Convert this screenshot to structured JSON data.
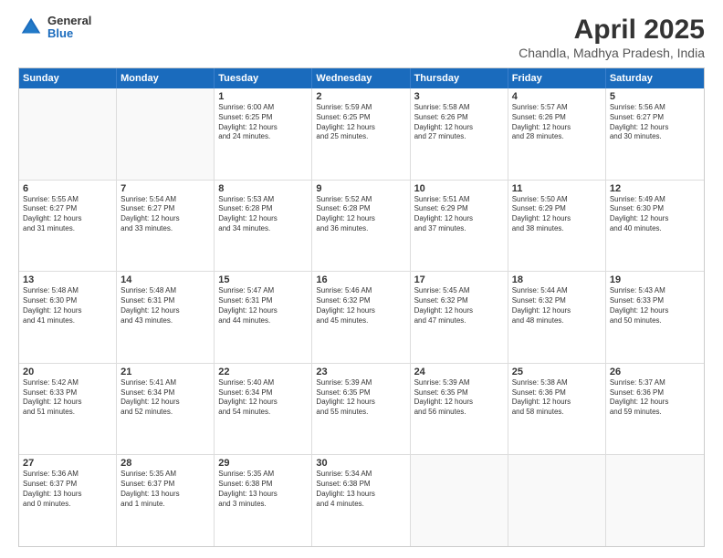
{
  "logo": {
    "line1": "General",
    "line2": "Blue"
  },
  "title": "April 2025",
  "subtitle": "Chandla, Madhya Pradesh, India",
  "header_days": [
    "Sunday",
    "Monday",
    "Tuesday",
    "Wednesday",
    "Thursday",
    "Friday",
    "Saturday"
  ],
  "rows": [
    [
      {
        "day": "",
        "info": ""
      },
      {
        "day": "",
        "info": ""
      },
      {
        "day": "1",
        "info": "Sunrise: 6:00 AM\nSunset: 6:25 PM\nDaylight: 12 hours\nand 24 minutes."
      },
      {
        "day": "2",
        "info": "Sunrise: 5:59 AM\nSunset: 6:25 PM\nDaylight: 12 hours\nand 25 minutes."
      },
      {
        "day": "3",
        "info": "Sunrise: 5:58 AM\nSunset: 6:26 PM\nDaylight: 12 hours\nand 27 minutes."
      },
      {
        "day": "4",
        "info": "Sunrise: 5:57 AM\nSunset: 6:26 PM\nDaylight: 12 hours\nand 28 minutes."
      },
      {
        "day": "5",
        "info": "Sunrise: 5:56 AM\nSunset: 6:27 PM\nDaylight: 12 hours\nand 30 minutes."
      }
    ],
    [
      {
        "day": "6",
        "info": "Sunrise: 5:55 AM\nSunset: 6:27 PM\nDaylight: 12 hours\nand 31 minutes."
      },
      {
        "day": "7",
        "info": "Sunrise: 5:54 AM\nSunset: 6:27 PM\nDaylight: 12 hours\nand 33 minutes."
      },
      {
        "day": "8",
        "info": "Sunrise: 5:53 AM\nSunset: 6:28 PM\nDaylight: 12 hours\nand 34 minutes."
      },
      {
        "day": "9",
        "info": "Sunrise: 5:52 AM\nSunset: 6:28 PM\nDaylight: 12 hours\nand 36 minutes."
      },
      {
        "day": "10",
        "info": "Sunrise: 5:51 AM\nSunset: 6:29 PM\nDaylight: 12 hours\nand 37 minutes."
      },
      {
        "day": "11",
        "info": "Sunrise: 5:50 AM\nSunset: 6:29 PM\nDaylight: 12 hours\nand 38 minutes."
      },
      {
        "day": "12",
        "info": "Sunrise: 5:49 AM\nSunset: 6:30 PM\nDaylight: 12 hours\nand 40 minutes."
      }
    ],
    [
      {
        "day": "13",
        "info": "Sunrise: 5:48 AM\nSunset: 6:30 PM\nDaylight: 12 hours\nand 41 minutes."
      },
      {
        "day": "14",
        "info": "Sunrise: 5:48 AM\nSunset: 6:31 PM\nDaylight: 12 hours\nand 43 minutes."
      },
      {
        "day": "15",
        "info": "Sunrise: 5:47 AM\nSunset: 6:31 PM\nDaylight: 12 hours\nand 44 minutes."
      },
      {
        "day": "16",
        "info": "Sunrise: 5:46 AM\nSunset: 6:32 PM\nDaylight: 12 hours\nand 45 minutes."
      },
      {
        "day": "17",
        "info": "Sunrise: 5:45 AM\nSunset: 6:32 PM\nDaylight: 12 hours\nand 47 minutes."
      },
      {
        "day": "18",
        "info": "Sunrise: 5:44 AM\nSunset: 6:32 PM\nDaylight: 12 hours\nand 48 minutes."
      },
      {
        "day": "19",
        "info": "Sunrise: 5:43 AM\nSunset: 6:33 PM\nDaylight: 12 hours\nand 50 minutes."
      }
    ],
    [
      {
        "day": "20",
        "info": "Sunrise: 5:42 AM\nSunset: 6:33 PM\nDaylight: 12 hours\nand 51 minutes."
      },
      {
        "day": "21",
        "info": "Sunrise: 5:41 AM\nSunset: 6:34 PM\nDaylight: 12 hours\nand 52 minutes."
      },
      {
        "day": "22",
        "info": "Sunrise: 5:40 AM\nSunset: 6:34 PM\nDaylight: 12 hours\nand 54 minutes."
      },
      {
        "day": "23",
        "info": "Sunrise: 5:39 AM\nSunset: 6:35 PM\nDaylight: 12 hours\nand 55 minutes."
      },
      {
        "day": "24",
        "info": "Sunrise: 5:39 AM\nSunset: 6:35 PM\nDaylight: 12 hours\nand 56 minutes."
      },
      {
        "day": "25",
        "info": "Sunrise: 5:38 AM\nSunset: 6:36 PM\nDaylight: 12 hours\nand 58 minutes."
      },
      {
        "day": "26",
        "info": "Sunrise: 5:37 AM\nSunset: 6:36 PM\nDaylight: 12 hours\nand 59 minutes."
      }
    ],
    [
      {
        "day": "27",
        "info": "Sunrise: 5:36 AM\nSunset: 6:37 PM\nDaylight: 13 hours\nand 0 minutes."
      },
      {
        "day": "28",
        "info": "Sunrise: 5:35 AM\nSunset: 6:37 PM\nDaylight: 13 hours\nand 1 minute."
      },
      {
        "day": "29",
        "info": "Sunrise: 5:35 AM\nSunset: 6:38 PM\nDaylight: 13 hours\nand 3 minutes."
      },
      {
        "day": "30",
        "info": "Sunrise: 5:34 AM\nSunset: 6:38 PM\nDaylight: 13 hours\nand 4 minutes."
      },
      {
        "day": "",
        "info": ""
      },
      {
        "day": "",
        "info": ""
      },
      {
        "day": "",
        "info": ""
      }
    ]
  ]
}
